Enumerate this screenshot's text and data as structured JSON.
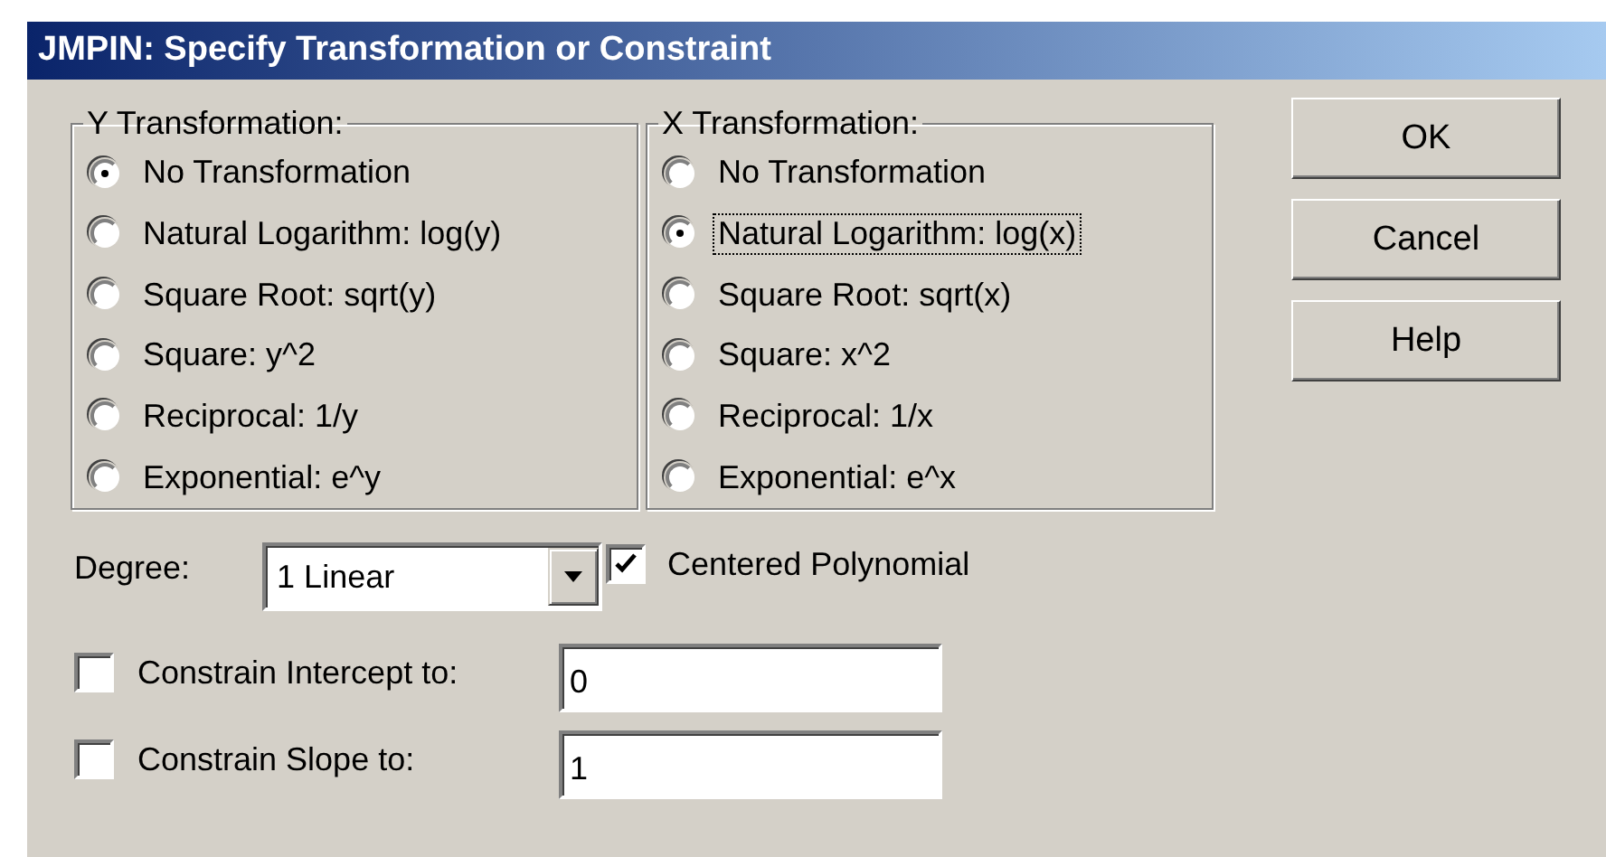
{
  "window": {
    "title": "JMPIN: Specify Transformation or Constraint"
  },
  "groups": [
    {
      "title": "Y Transformation:",
      "options": [
        {
          "label": "No Transformation",
          "selected": true,
          "focused": false
        },
        {
          "label": "Natural Logarithm: log(y)",
          "selected": false,
          "focused": false
        },
        {
          "label": "Square Root: sqrt(y)",
          "selected": false,
          "focused": false
        },
        {
          "label": "Square: y^2",
          "selected": false,
          "focused": false
        },
        {
          "label": "Reciprocal: 1/y",
          "selected": false,
          "focused": false
        },
        {
          "label": "Exponential: e^y",
          "selected": false,
          "focused": false
        }
      ]
    },
    {
      "title": "X Transformation:",
      "options": [
        {
          "label": "No Transformation",
          "selected": false,
          "focused": false
        },
        {
          "label": "Natural Logarithm: log(x)",
          "selected": true,
          "focused": true
        },
        {
          "label": "Square Root: sqrt(x)",
          "selected": false,
          "focused": false
        },
        {
          "label": "Square: x^2",
          "selected": false,
          "focused": false
        },
        {
          "label": "Reciprocal: 1/x",
          "selected": false,
          "focused": false
        },
        {
          "label": "Exponential: e^x",
          "selected": false,
          "focused": false
        }
      ]
    }
  ],
  "buttons": [
    "OK",
    "Cancel",
    "Help"
  ],
  "degree": {
    "label": "Degree:",
    "value": "1 Linear"
  },
  "centered": {
    "label": "Centered Polynomial",
    "checked": true
  },
  "constraints": [
    {
      "label": "Constrain Intercept to:",
      "checked": false,
      "value": "0"
    },
    {
      "label": "Constrain Slope to:",
      "checked": false,
      "value": "1"
    }
  ]
}
